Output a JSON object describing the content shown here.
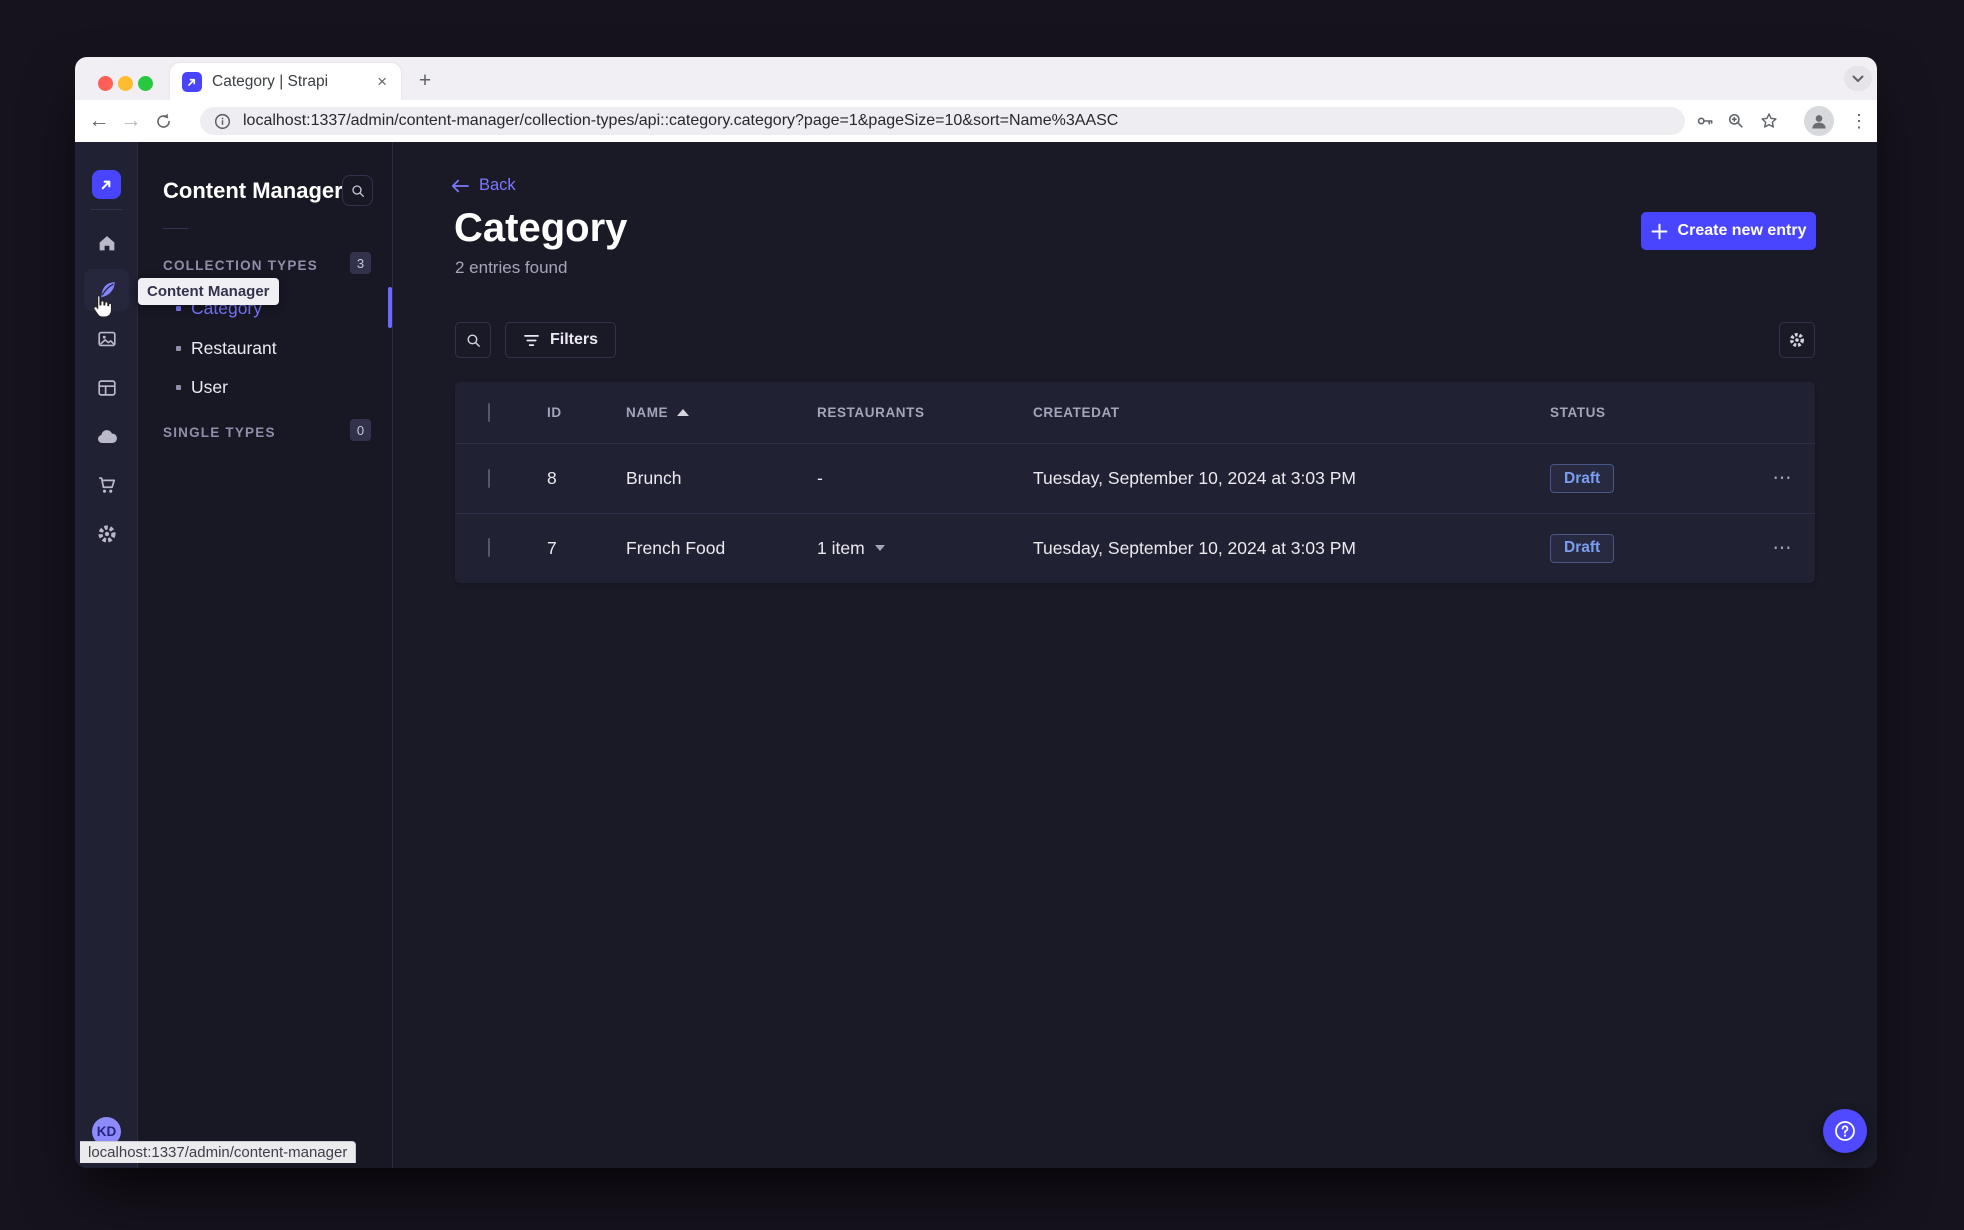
{
  "browser": {
    "tab_title": "Category | Strapi",
    "url": "localhost:1337/admin/content-manager/collection-types/api::category.category?page=1&pageSize=10&sort=Name%3AASC",
    "status_bubble": "localhost:1337/admin/content-manager"
  },
  "glyphs": {
    "back": "←",
    "forward": "→",
    "close": "×",
    "plus": "+",
    "more_v": "⋮",
    "more_h": "⋯"
  },
  "rail": {
    "user_initials": "KD"
  },
  "subnav": {
    "title": "Content Manager",
    "tooltip": "Content Manager",
    "collection_types_label": "COLLECTION TYPES",
    "collection_types_count": "3",
    "single_types_label": "SINGLE TYPES",
    "single_types_count": "0",
    "items": [
      {
        "label": "Category",
        "active": true
      },
      {
        "label": "Restaurant",
        "active": false
      },
      {
        "label": "User",
        "active": false
      }
    ]
  },
  "main": {
    "back_label": "Back",
    "title": "Category",
    "subtitle": "2 entries found",
    "create_button_label": "Create new entry",
    "filters_button_label": "Filters",
    "table": {
      "headers": {
        "id": "ID",
        "name": "NAME",
        "restaurants": "RESTAURANTS",
        "createdat": "CREATEDAT",
        "status": "STATUS"
      },
      "rows": [
        {
          "id": "8",
          "name": "Brunch",
          "restaurants": "-",
          "createdat": "Tuesday, September 10, 2024 at 3:03 PM",
          "status": "Draft"
        },
        {
          "id": "7",
          "name": "French Food",
          "restaurants": "1 item",
          "createdat": "Tuesday, September 10, 2024 at 3:03 PM",
          "status": "Draft"
        }
      ]
    }
  },
  "colors": {
    "brand": "#4945ff",
    "link": "#7b79ff",
    "page_bg": "#181826",
    "panel_bg": "#212134",
    "draft_text": "#7b9ff0"
  }
}
